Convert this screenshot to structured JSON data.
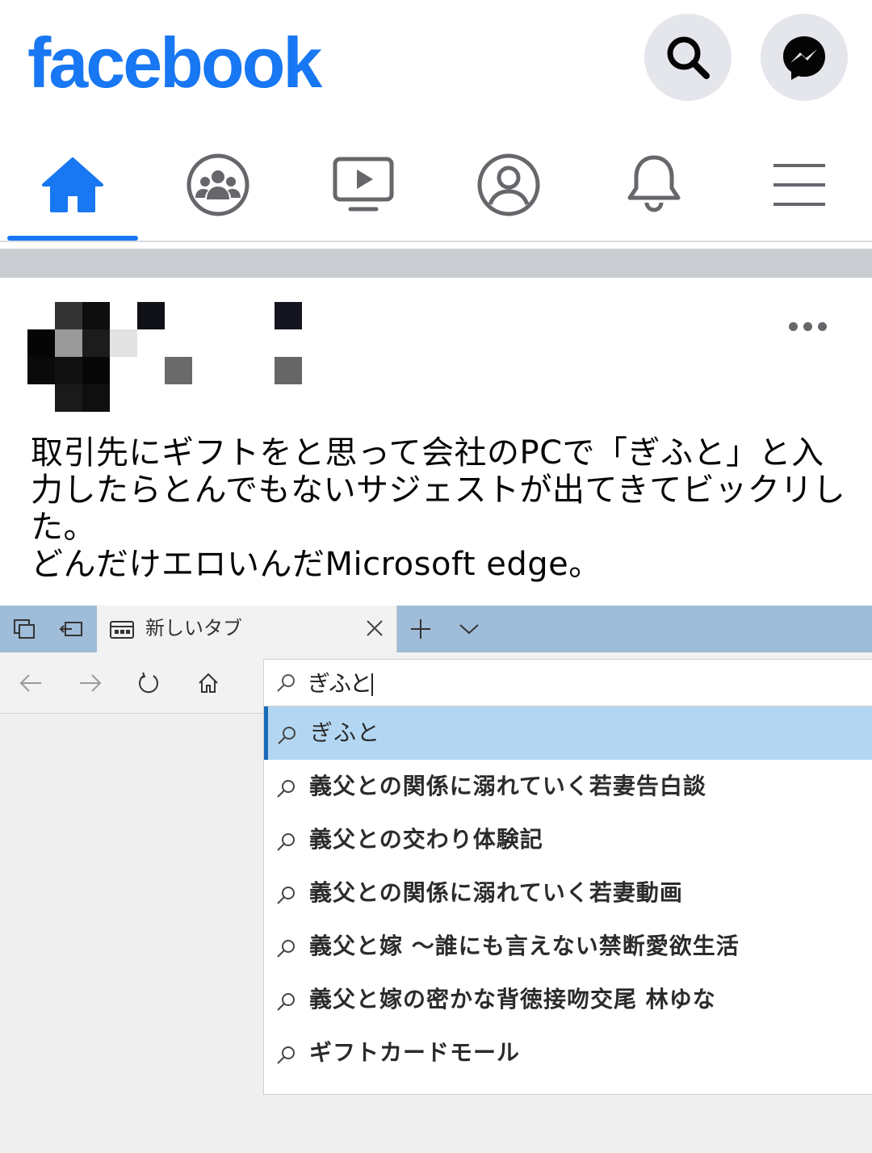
{
  "app": {
    "logo_text": "facebook",
    "brand_color": "#1877f2"
  },
  "header": {
    "search_icon": "search-icon",
    "messenger_icon": "messenger-icon"
  },
  "nav": {
    "active": "home",
    "items": [
      {
        "icon": "home-icon"
      },
      {
        "icon": "groups-icon"
      },
      {
        "icon": "watch-icon"
      },
      {
        "icon": "profile-icon"
      },
      {
        "icon": "bell-icon"
      },
      {
        "icon": "menu-icon"
      }
    ]
  },
  "post": {
    "author_avatar": "pixelated-avatar",
    "author_name": "pixelated-name",
    "more_icon": "more-options-icon",
    "text": "取引先にギフトをと思って会社のPCで「ぎふと」と入力したらとんでもないサジェストが出てきてビックリした。\nどんだけエロいんだMicrosoft edge。"
  },
  "screenshot": {
    "tab": {
      "title": "新しいタブ"
    },
    "address": {
      "value": "ぎふと"
    },
    "suggestions": [
      {
        "label": "ぎふと",
        "selected": true
      },
      {
        "label": "義父との関係に溺れていく若妻告白談"
      },
      {
        "label": "義父との交わり体験記"
      },
      {
        "label": "義父との関係に溺れていく若妻動画"
      },
      {
        "label": "義父と嫁 ～誰にも言えない禁断愛欲生活"
      },
      {
        "label": "義父と嫁の密かな背徳接吻交尾 林ゆな"
      },
      {
        "label": "ギフトカードモール"
      }
    ],
    "colors": {
      "tabbar": "#9fbcd8",
      "selected": "#b3d7f2",
      "selected_border": "#1a6bb8"
    }
  }
}
